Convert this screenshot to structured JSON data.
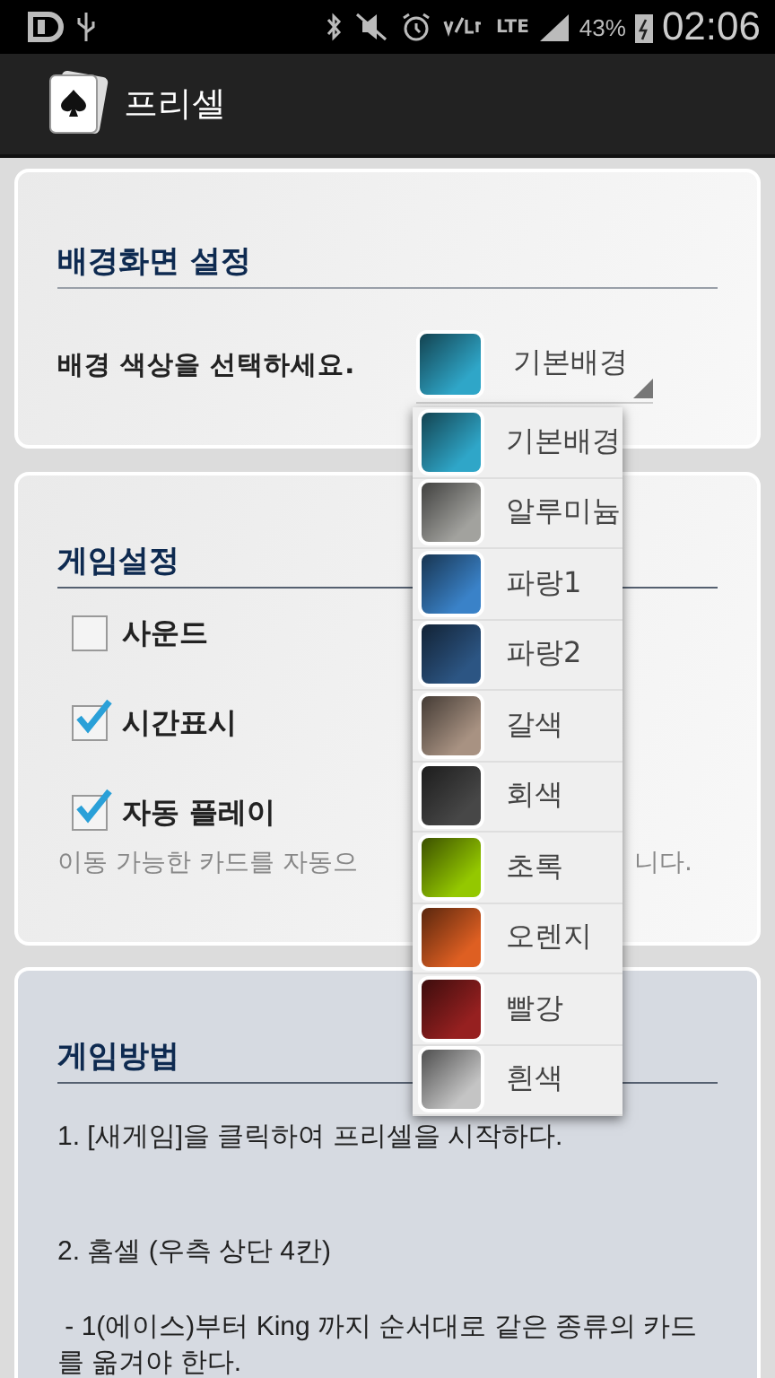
{
  "status_bar": {
    "network": "LTE",
    "battery": "43%",
    "time": "02:06"
  },
  "app_bar": {
    "title": "프리셀"
  },
  "background_section": {
    "heading": "배경화면 설정",
    "label": "배경 색상을 선택하세요.",
    "spinner": {
      "value": "기본배경",
      "color": "#2fa6c8"
    }
  },
  "dropdown": [
    {
      "label": "기본배경",
      "color": "#2fa6c8"
    },
    {
      "label": "알루미늄",
      "color": "#a2a29e"
    },
    {
      "label": "파랑1",
      "color": "#3a82c8"
    },
    {
      "label": "파랑2",
      "color": "#2c5583"
    },
    {
      "label": "갈색",
      "color": "#a89282"
    },
    {
      "label": "회색",
      "color": "#474747"
    },
    {
      "label": "초록",
      "color": "#94c800"
    },
    {
      "label": "오렌지",
      "color": "#de5f22"
    },
    {
      "label": "빨강",
      "color": "#962020"
    },
    {
      "label": "흰색",
      "color": "#c4c4c4"
    }
  ],
  "game_settings": {
    "heading": "게임설정",
    "options": [
      {
        "label": "사운드",
        "checked": false
      },
      {
        "label": "시간표시",
        "checked": true
      },
      {
        "label": "자동 플레이",
        "checked": true
      }
    ],
    "hint_left": "이동 가능한 카드를 자동으",
    "hint_right": "니다."
  },
  "how_to_play": {
    "heading": "게임방법",
    "paragraphs": [
      "1. [새게임]을 클릭하여 프리셀을 시작하다.",
      "2. 홈셀 (우측 상단 4칸)",
      " - 1(에이스)부터 King 까지 순서대로 같은 종류의 카드를 옮겨야 한다."
    ]
  }
}
